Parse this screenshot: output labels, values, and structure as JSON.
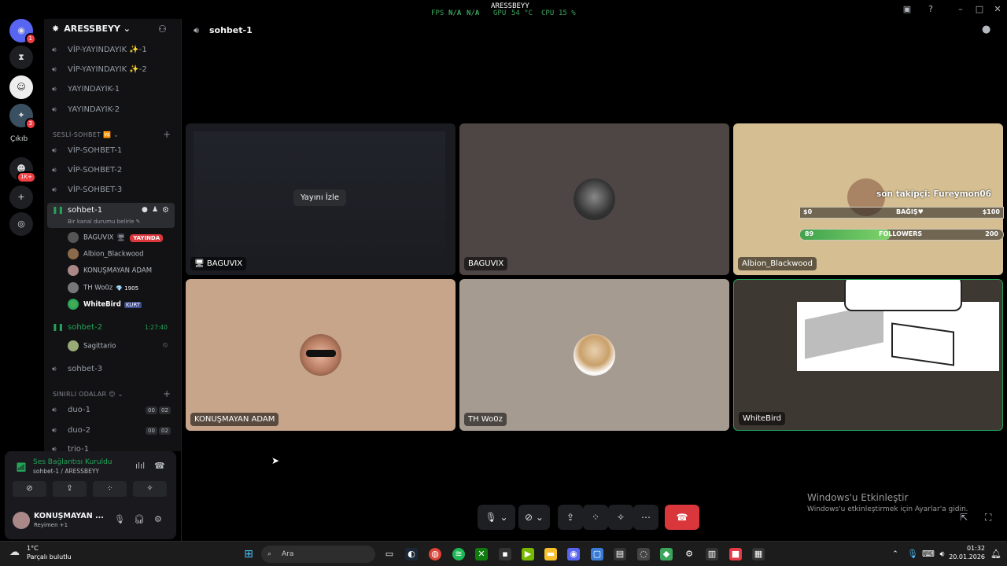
{
  "titlebar": {
    "overlay": {
      "fps_label": "FPS",
      "fps_value": "N/A",
      "fps_value2": "N/A",
      "gpu_label": "GPU",
      "gpu_value": "54 °C",
      "cpu_label": "CPU",
      "cpu_value": "15 %",
      "user": "ARESSBEYY"
    }
  },
  "rail": {
    "badge_home": "1",
    "badge_server3": "3",
    "label_cikis": "Çıkıb",
    "badge_1k": "1K+"
  },
  "guild": {
    "name": "ARESSBEYY ⌄"
  },
  "channels": {
    "vip1": "VİP-YAYINDAYIK ✨-1",
    "vip2": "VİP-YAYINDAYIK ✨-2",
    "y1": "YAYINDAYIK-1",
    "y2": "YAYINDAYIK-2",
    "cat_sesli": "SESLİ-SOHBET 🆚 ⌄",
    "vs1": "VİP-SOHBET-1",
    "vs2": "VİP-SOHBET-2",
    "vs3": "VİP-SOHBET-3",
    "sohbet1": "sohbet-1",
    "sohbet1_status": "Bir kanal durumu belirle ✎",
    "sohbet2": "sohbet-2",
    "sohbet2_time": "1:27:40",
    "sohbet3": "sohbet-3",
    "cat_sinirli": "SINIRLI ODALAR 😊 ⌄",
    "duo1": "duo-1",
    "duo2": "duo-2",
    "duo_count_a": "00",
    "duo_count_b": "02",
    "trio1": "trio-1"
  },
  "voice_users": {
    "u1": "BAGUVIX",
    "u1_live": "YAYINDA",
    "u2": "Albion_Blackwood",
    "u3": "KONUŞMAYAN ADAM",
    "u4": "TH Wo0z",
    "u4_tag": "💎 1905",
    "u5": "WhiteBird",
    "u5_tag": "KURT",
    "s2u1": "Sagittario"
  },
  "voice_panel": {
    "status": "Ses Bağlantısı Kuruldu",
    "channel": "sohbet-1 / ARESSBEYY",
    "username": "KONUŞMAYAN ...",
    "substatus": "Reyimen +1"
  },
  "main": {
    "channel_title": "sohbet-1",
    "watch_stream": "Yayını İzle",
    "tiles": {
      "t1": "BAGUVIX",
      "t2": "BAGUVIX",
      "t3": "Albion_Blackwood",
      "t4": "KONUŞMAYAN ADAM",
      "t5": "TH Wo0z",
      "t6": "WhiteBird"
    },
    "stream_overlay": {
      "follower": "son takipçi: Fureymon06",
      "donate_min": "$0",
      "donate_label": "BAĞIŞ♥",
      "donate_max": "$100",
      "follow_current": "89",
      "follow_label": "FOLLOWERS",
      "follow_max": "200",
      "follow_progress": 0.445
    }
  },
  "activation": {
    "line1": "Windows'u Etkinleştir",
    "line2": "Windows'u etkinleştirmek için Ayarlar'a gidin."
  },
  "taskbar": {
    "weather_temp": "1°C",
    "weather_desc": "Parçalı bulutlu",
    "search_placeholder": "Ara",
    "time": "01:32",
    "date": "20.01.2026"
  },
  "colors": {
    "accent_green": "#23a55a",
    "live_red": "#da373c",
    "hangup": "#da373c"
  }
}
